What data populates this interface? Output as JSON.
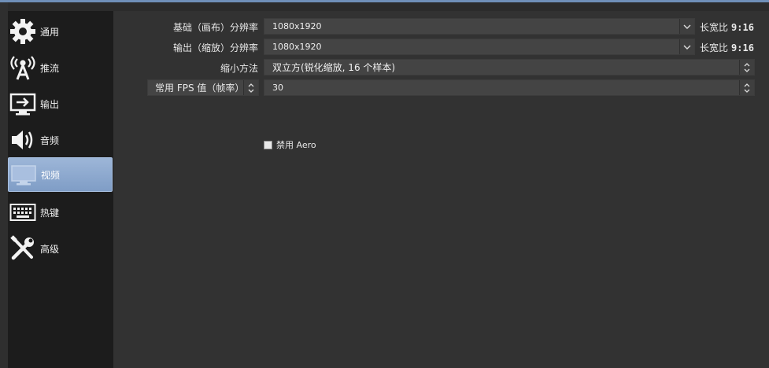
{
  "sidebar": {
    "items": [
      {
        "label": "通用",
        "icon": "gear-icon"
      },
      {
        "label": "推流",
        "icon": "broadcast-icon"
      },
      {
        "label": "输出",
        "icon": "output-icon"
      },
      {
        "label": "音频",
        "icon": "speaker-icon"
      },
      {
        "label": "视频",
        "icon": "monitor-icon",
        "selected": true
      },
      {
        "label": "热键",
        "icon": "keyboard-icon"
      },
      {
        "label": "高级",
        "icon": "tools-icon"
      }
    ]
  },
  "video": {
    "base_resolution": {
      "label": "基础（画布）分辨率",
      "value": "1080x1920",
      "ratio_label": "长宽比",
      "ratio_value": "9:16"
    },
    "output_resolution": {
      "label": "输出（缩放）分辨率",
      "value": "1080x1920",
      "ratio_label": "长宽比",
      "ratio_value": "9:16"
    },
    "downscale_filter": {
      "label": "缩小方法",
      "value": "双立方(锐化缩放, 16 个样本)"
    },
    "fps": {
      "type_label": "常用 FPS 值（帧率）",
      "value": "30"
    },
    "disable_aero": {
      "label": "禁用 Aero",
      "checked": false
    }
  },
  "colors": {
    "accent": "#8aa6cd",
    "sidebar_bg": "#1c1c1c",
    "content_bg": "#323232",
    "field_bg": "#444444"
  }
}
